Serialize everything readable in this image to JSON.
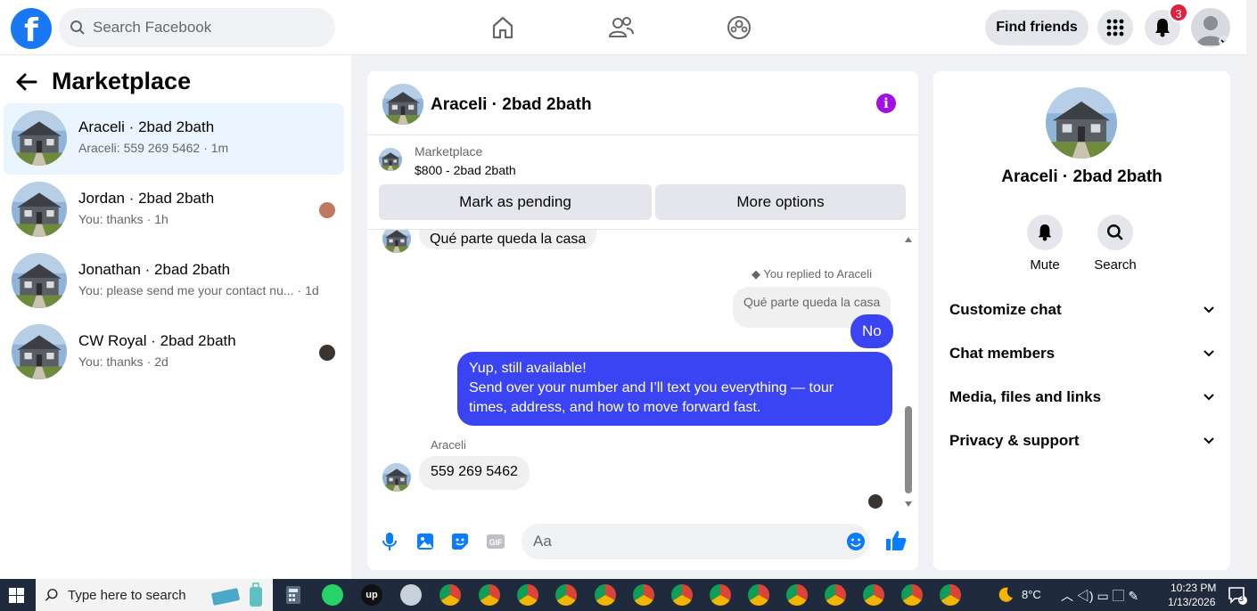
{
  "header": {
    "logo_letter": "f",
    "search_placeholder": "Search Facebook",
    "find_friends_label": "Find friends",
    "notification_count": "3"
  },
  "sidebar": {
    "title": "Marketplace",
    "conversations": [
      {
        "name": "Araceli · 2bad 2bath",
        "preview": "Araceli: 559 269 5462",
        "time": "· 1m"
      },
      {
        "name": "Jordan · 2bad 2bath",
        "preview": "You: thanks",
        "time": "· 1h"
      },
      {
        "name": "Jonathan · 2bad 2bath",
        "preview": "You: please send me your contact nu...",
        "time": "· 1d"
      },
      {
        "name": "CW Royal · 2bad 2bath",
        "preview": "You: thanks",
        "time": "· 2d"
      }
    ]
  },
  "chat": {
    "title": "Araceli · 2bad 2bath",
    "marketplace_label": "Marketplace",
    "listing": "$800 - 2bad 2bath",
    "mark_pending_label": "Mark as pending",
    "more_options_label": "More options",
    "messages": {
      "partial_top": "Qué parte queda la casa",
      "replied_note": "You replied to Araceli",
      "quoted": "Qué parte queda la casa",
      "reply_no": "No",
      "sent_line1": "Yup, still available!",
      "sent_line2": "Send over your number and I’ll text you everything — tour",
      "sent_line3": "times, address, and how to move forward fast.",
      "sender_name": "Araceli",
      "received": "559 269 5462"
    },
    "composer_placeholder": "Aa"
  },
  "details": {
    "name": "Araceli · 2bad 2bath",
    "mute_label": "Mute",
    "search_label": "Search",
    "sections": [
      "Customize chat",
      "Chat members",
      "Media, files and links",
      "Privacy & support"
    ]
  },
  "taskbar": {
    "search_placeholder": "Type here to search",
    "weather": "8°C",
    "time": "10:23 PM",
    "date": "1/13/2026",
    "notification_count": "3"
  },
  "colors": {
    "brand_blue": "#1877f2",
    "sent_bubble": "#3b44f2",
    "info_purple": "#a20fe6",
    "badge_red": "#e41e3f"
  }
}
